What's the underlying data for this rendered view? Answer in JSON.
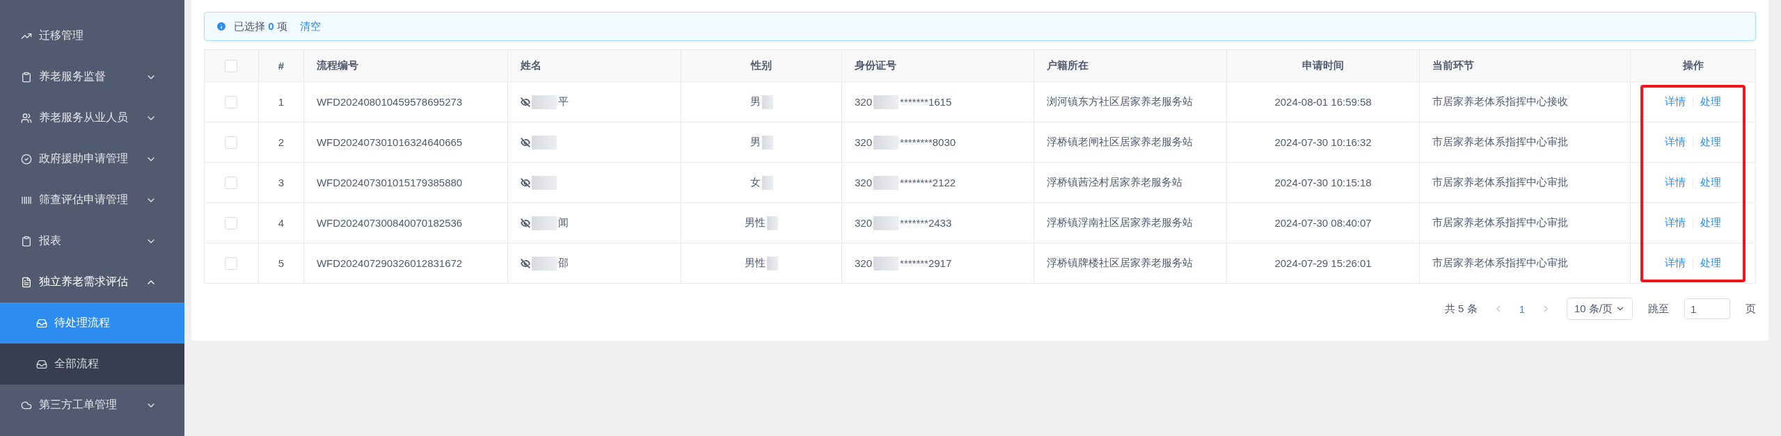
{
  "sidebar": {
    "items": [
      {
        "label": "迁移管理",
        "kind": "link"
      },
      {
        "label": "养老服务监督",
        "kind": "group",
        "expanded": false
      },
      {
        "label": "养老服务从业人员",
        "kind": "group",
        "expanded": false
      },
      {
        "label": "政府援助申请管理",
        "kind": "group",
        "expanded": false
      },
      {
        "label": "筛查评估申请管理",
        "kind": "group",
        "expanded": false
      },
      {
        "label": "报表",
        "kind": "group",
        "expanded": false
      },
      {
        "label": "独立养老需求评估",
        "kind": "group",
        "expanded": true,
        "children": [
          {
            "label": "待处理流程",
            "selected": true
          },
          {
            "label": "全部流程",
            "selected": false
          }
        ]
      },
      {
        "label": "第三方工单管理",
        "kind": "group",
        "expanded": false
      }
    ]
  },
  "alert": {
    "prefix": "已选择",
    "count": "0",
    "suffix": "项",
    "clear": "清空"
  },
  "table": {
    "all_checked": false,
    "columns": [
      "#",
      "流程编号",
      "姓名",
      "性别",
      "身份证号",
      "户籍所在",
      "申请时间",
      "当前环节",
      "操作"
    ],
    "rows": [
      {
        "checked": false,
        "index": "1",
        "id": "WFD202408010459578695273",
        "name": "平",
        "gender": "男",
        "idcard_start": "320",
        "idcard_end": "*******1615",
        "address": "浏河镇东方社区居家养老服务站",
        "time": "2024-08-01 16:59:58",
        "stage": "市居家养老体系指挥中心接收",
        "actions": [
          "详情",
          "处理"
        ]
      },
      {
        "checked": false,
        "index": "2",
        "id": "WFD202407301016324640665",
        "gender": "男",
        "idcard_start": "320",
        "idcard_end": "********8030",
        "address": "浮桥镇老闸社区居家养老服务站",
        "time": "2024-07-30 10:16:32",
        "stage": "市居家养老体系指挥中心审批",
        "actions": [
          "详情",
          "处理"
        ]
      },
      {
        "checked": false,
        "index": "3",
        "id": "WFD202407301015179385880",
        "gender": "女",
        "idcard_start": "320",
        "idcard_end": "********2122",
        "address": "浮桥镇茜泾村居家养老服务站",
        "time": "2024-07-30 10:15:18",
        "stage": "市居家养老体系指挥中心审批",
        "actions": [
          "详情",
          "处理"
        ]
      },
      {
        "checked": false,
        "index": "4",
        "id": "WFD202407300840070182536",
        "name": "闻",
        "gender": "男性",
        "idcard_start": "320",
        "idcard_end": "*******2433",
        "address": "浮桥镇浮南社区居家养老服务站",
        "time": "2024-07-30 08:40:07",
        "stage": "市居家养老体系指挥中心审批",
        "actions": [
          "详情",
          "处理"
        ]
      },
      {
        "checked": false,
        "index": "5",
        "id": "WFD202407290326012831672",
        "name": "邵",
        "gender": "男性",
        "idcard_start": "320",
        "idcard_end": "*******2917",
        "address": "浮桥镇牌楼社区居家养老服务站",
        "time": "2024-07-29 15:26:01",
        "stage": "市居家养老体系指挥中心审批",
        "actions": [
          "详情",
          "处理"
        ]
      }
    ]
  },
  "pagination": {
    "total": "共 5 条",
    "pages": [
      {
        "label": "1",
        "selected": true
      }
    ],
    "page_size": "10 条/页",
    "jump_label": "跳至",
    "jump_value": "1",
    "page_suffix": "页"
  }
}
